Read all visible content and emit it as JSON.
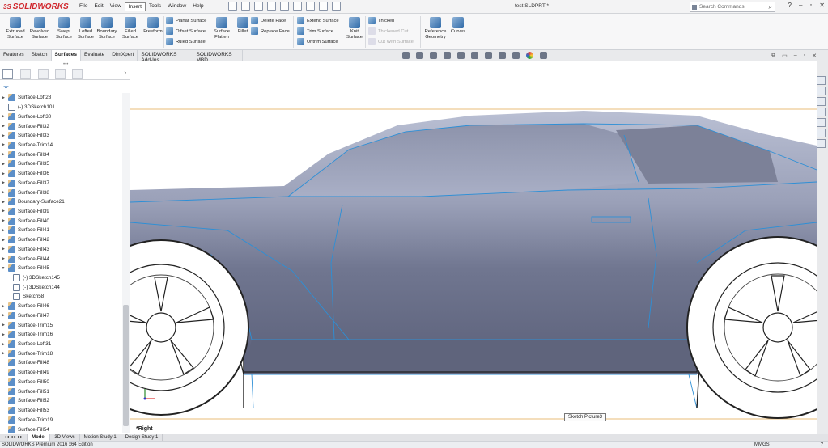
{
  "app": {
    "brand": "SOLIDWORKS",
    "brand_mark": "3S",
    "document_title": "test.SLDPRT *"
  },
  "menu": [
    "File",
    "Edit",
    "View",
    "Insert",
    "Tools",
    "Window",
    "Help"
  ],
  "menu_active": "Insert",
  "search": {
    "placeholder": "Search Commands"
  },
  "ribbon": {
    "big": [
      {
        "label": "Extruded Surface",
        "icon": "extruded-surface-icon"
      },
      {
        "label": "Revolved Surface",
        "icon": "revolved-surface-icon"
      },
      {
        "label": "Swept Surface",
        "icon": "swept-surface-icon"
      },
      {
        "label": "Lofted Surface",
        "icon": "lofted-surface-icon"
      },
      {
        "label": "Boundary Surface",
        "icon": "boundary-surface-icon"
      },
      {
        "label": "Filled Surface",
        "icon": "filled-surface-icon"
      },
      {
        "label": "Freeform",
        "icon": "freeform-icon"
      }
    ],
    "col1": [
      "Planar Surface",
      "Offset Surface",
      "Ruled Surface"
    ],
    "big2": [
      {
        "label": "Surface Flatten",
        "icon": "surface-flatten-icon"
      },
      {
        "label": "Fillet",
        "icon": "fillet-icon"
      }
    ],
    "col2": [
      "Delete Face",
      "Replace Face"
    ],
    "col3": [
      "Extend Surface",
      "Trim Surface",
      "Untrim Surface"
    ],
    "big3": [
      {
        "label": "Knit Surface",
        "icon": "knit-surface-icon"
      }
    ],
    "col4": [
      {
        "label": "Thicken",
        "disabled": false
      },
      {
        "label": "Thickened Cut",
        "disabled": true
      },
      {
        "label": "Cut With Surface",
        "disabled": true
      }
    ],
    "big4": [
      {
        "label": "Reference Geometry",
        "icon": "reference-geometry-icon"
      },
      {
        "label": "Curves",
        "icon": "curves-icon"
      }
    ]
  },
  "command_tabs": [
    "Features",
    "Sketch",
    "Surfaces",
    "Evaluate",
    "DimXpert",
    "SOLIDWORKS Add-Ins",
    "SOLIDWORKS MBD"
  ],
  "active_tab": "Surfaces",
  "tree": [
    {
      "label": "Surface-Loft28",
      "expand": true
    },
    {
      "label": "(-) 3DSketch101",
      "expand": false,
      "sketch": true
    },
    {
      "label": "Surface-Loft30",
      "expand": true
    },
    {
      "label": "Surface-Fill32",
      "expand": true
    },
    {
      "label": "Surface-Fill33",
      "expand": true
    },
    {
      "label": "Surface-Trim14",
      "expand": true
    },
    {
      "label": "Surface-Fill34",
      "expand": true
    },
    {
      "label": "Surface-Fill35",
      "expand": true
    },
    {
      "label": "Surface-Fill36",
      "expand": true
    },
    {
      "label": "Surface-Fill37",
      "expand": true
    },
    {
      "label": "Surface-Fill38",
      "expand": true
    },
    {
      "label": "Boundary-Surface21",
      "expand": true
    },
    {
      "label": "Surface-Fill39",
      "expand": true
    },
    {
      "label": "Surface-Fill40",
      "expand": true
    },
    {
      "label": "Surface-Fill41",
      "expand": true
    },
    {
      "label": "Surface-Fill42",
      "expand": true
    },
    {
      "label": "Surface-Fill43",
      "expand": true
    },
    {
      "label": "Surface-Fill44",
      "expand": true
    },
    {
      "label": "Surface-Fill45",
      "expand": true,
      "open": true
    },
    {
      "label": "(-) 3DSketch145",
      "child": true,
      "sketch": true
    },
    {
      "label": "(-) 3DSketch144",
      "child": true,
      "sketch": true
    },
    {
      "label": "Sketch58",
      "child": true,
      "sketch": true
    },
    {
      "label": "Surface-Fill46",
      "expand": true
    },
    {
      "label": "Surface-Fill47",
      "expand": true
    },
    {
      "label": "Surface-Trim15",
      "expand": true
    },
    {
      "label": "Surface-Trim16",
      "expand": true
    },
    {
      "label": "Surface-Loft31",
      "expand": true
    },
    {
      "label": "Surface-Trim18",
      "expand": true
    },
    {
      "label": "Surface-Fill48",
      "expand": false
    },
    {
      "label": "Surface-Fill49",
      "expand": false
    },
    {
      "label": "Surface-Fill50",
      "expand": false
    },
    {
      "label": "Surface-Fill51",
      "expand": false
    },
    {
      "label": "Surface-Fill52",
      "expand": false
    },
    {
      "label": "Surface-Fill53",
      "expand": false
    },
    {
      "label": "Surface-Trim19",
      "expand": false
    },
    {
      "label": "Surface-Fill54",
      "expand": false
    }
  ],
  "viewport": {
    "view_label": "*Right",
    "tooltip": "Sketch Picture3"
  },
  "bottom_tabs": [
    "Model",
    "3D Views",
    "Motion Study 1",
    "Design Study 1"
  ],
  "bottom_active": "Model",
  "status": {
    "edition": "SOLIDWORKS Premium 2016 x64 Edition",
    "units": "MMGS"
  },
  "colors": {
    "accent": "#d0252b",
    "surface_edge": "#2d8fd6",
    "body": "#7a7f97"
  }
}
